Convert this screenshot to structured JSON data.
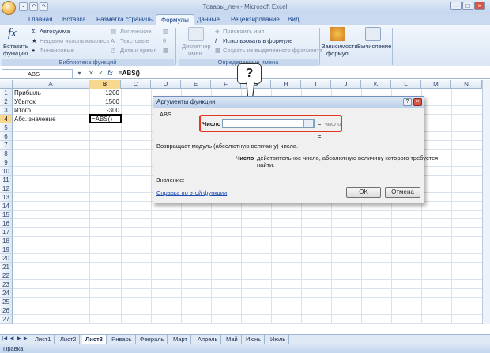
{
  "window": {
    "title": "Товары_лен - Microsoft Excel",
    "minimize": "–",
    "restore": "□",
    "close": "×"
  },
  "ribbon_tabs": [
    "Главная",
    "Вставка",
    "Разметка страницы",
    "Формулы",
    "Данные",
    "Рецензирование",
    "Вид"
  ],
  "ribbon": {
    "insert_function": [
      "Вставить",
      "функцию"
    ],
    "autosum": "Автосумма",
    "recently_used": "Недавно использовались",
    "financial": "Финансовые",
    "logical": "Логические",
    "text": "Текстовые",
    "datetime": "Дата и время",
    "group_library": "Библиотека функций",
    "name_manager": [
      "Диспетчер",
      "имен"
    ],
    "assign_name": "Присвоить имя",
    "use_in_formula": "Использовать в формуле",
    "create_from_selection": "Создать из выделенного фрагмента",
    "group_names": "Определенные имена",
    "dependencies": [
      "Зависимости",
      "формул"
    ],
    "calculation": "Вычисление"
  },
  "formula_bar": {
    "name_box": "ABS",
    "formula": "=ABS()"
  },
  "columns": [
    "A",
    "B",
    "C",
    "D",
    "E",
    "F",
    "G",
    "H",
    "I",
    "J",
    "K",
    "L",
    "M",
    "N"
  ],
  "rows": [
    "1",
    "2",
    "3",
    "4",
    "5",
    "6",
    "7",
    "8",
    "9",
    "10",
    "11",
    "12",
    "13",
    "14",
    "15",
    "16",
    "17",
    "18",
    "19",
    "20",
    "21",
    "22",
    "23",
    "24",
    "25",
    "26",
    "27"
  ],
  "cells": {
    "a1": "Прибыль",
    "b1": "1200",
    "a2": "Убыток",
    "b2": "1500",
    "a3": "Итого",
    "b3": "-300",
    "a4": "Абс. значение",
    "b4": "=ABS()"
  },
  "dialog": {
    "title": "Аргументы функции",
    "help_btn": "?",
    "close_btn": "×",
    "function_name": "ABS",
    "arg_label": "Число",
    "arg_eq": "=",
    "arg_hint": "число",
    "result_eq": "=",
    "description": "Возвращает модуль (абсолютную величину) числа.",
    "param_name": "Число",
    "param_desc": [
      "действительное число, абсолютную величину которого требуется",
      "найти."
    ],
    "value_label": "Значение:",
    "help_link": "Справка по этой функции",
    "ok": "OK",
    "cancel": "Отмена"
  },
  "callout": "?",
  "sheet_tabs": [
    "Лист1",
    "Лист2",
    "Лист3",
    "Январь",
    "Февраль",
    "Март",
    "Апрель",
    "Май",
    "Июнь",
    "Июль"
  ],
  "active_sheet": "Лист3",
  "status": "Правка",
  "colors": {
    "accent": "#c5d6ee",
    "highlight": "#e03820",
    "selected_header": "#f8d88e"
  }
}
